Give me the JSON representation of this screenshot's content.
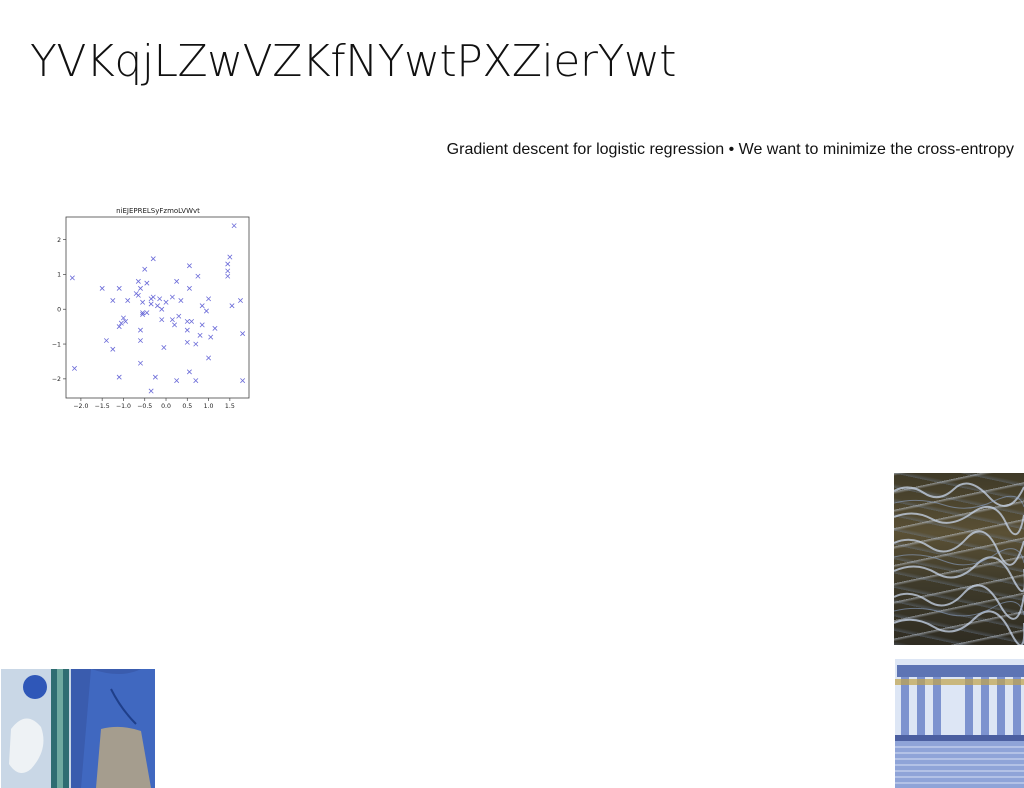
{
  "slide": {
    "title": "YVKqjLZwVZKfNYwtPXZierYwt",
    "subtitle": "Gradient descent for logistic regression • We want to minimize the cross-entropy"
  },
  "chart_data": {
    "type": "scatter",
    "title": "niEJEPRELSyFzmoLVWvt",
    "xlabel": "",
    "ylabel": "",
    "xlim": [
      -2.35,
      1.95
    ],
    "ylim": [
      -2.55,
      2.65
    ],
    "xticks": [
      "−2.0",
      "−1.5",
      "−1.0",
      "−0.5",
      "0.0",
      "0.5",
      "1.0",
      "1.5"
    ],
    "yticks": [
      "2",
      "1",
      "0",
      "−1",
      "−2"
    ],
    "marker": "x",
    "color": "#6a6ad8",
    "grid": false,
    "points": [
      [
        1.6,
        2.4
      ],
      [
        -0.3,
        1.45
      ],
      [
        1.5,
        1.5
      ],
      [
        1.45,
        1.3
      ],
      [
        1.45,
        1.1
      ],
      [
        -0.5,
        1.15
      ],
      [
        0.55,
        1.25
      ],
      [
        -2.2,
        0.9
      ],
      [
        1.45,
        0.95
      ],
      [
        0.75,
        0.95
      ],
      [
        0.25,
        0.8
      ],
      [
        -0.65,
        0.8
      ],
      [
        -0.45,
        0.75
      ],
      [
        -1.5,
        0.6
      ],
      [
        -1.1,
        0.6
      ],
      [
        -0.6,
        0.6
      ],
      [
        0.55,
        0.6
      ],
      [
        -0.7,
        0.45
      ],
      [
        -0.65,
        0.4
      ],
      [
        -0.3,
        0.35
      ],
      [
        -0.35,
        0.3
      ],
      [
        0.15,
        0.35
      ],
      [
        -0.15,
        0.3
      ],
      [
        0.35,
        0.25
      ],
      [
        -1.25,
        0.25
      ],
      [
        -0.9,
        0.25
      ],
      [
        -0.55,
        0.2
      ],
      [
        0.0,
        0.2
      ],
      [
        1.0,
        0.3
      ],
      [
        1.75,
        0.25
      ],
      [
        -0.35,
        0.15
      ],
      [
        -0.2,
        0.1
      ],
      [
        0.85,
        0.1
      ],
      [
        1.55,
        0.1
      ],
      [
        -0.1,
        0.0
      ],
      [
        0.95,
        -0.05
      ],
      [
        -0.55,
        -0.1
      ],
      [
        -0.55,
        -0.15
      ],
      [
        -0.45,
        -0.1
      ],
      [
        0.3,
        -0.2
      ],
      [
        -1.0,
        -0.25
      ],
      [
        -0.1,
        -0.3
      ],
      [
        0.15,
        -0.3
      ],
      [
        0.5,
        -0.35
      ],
      [
        0.6,
        -0.35
      ],
      [
        -1.05,
        -0.4
      ],
      [
        -0.95,
        -0.35
      ],
      [
        -1.1,
        -0.5
      ],
      [
        0.2,
        -0.45
      ],
      [
        0.85,
        -0.45
      ],
      [
        1.15,
        -0.55
      ],
      [
        0.5,
        -0.6
      ],
      [
        -0.6,
        -0.6
      ],
      [
        0.8,
        -0.75
      ],
      [
        1.05,
        -0.8
      ],
      [
        1.8,
        -0.7
      ],
      [
        -1.4,
        -0.9
      ],
      [
        -0.6,
        -0.9
      ],
      [
        0.5,
        -0.95
      ],
      [
        0.7,
        -1.0
      ],
      [
        -0.05,
        -1.1
      ],
      [
        -1.25,
        -1.15
      ],
      [
        1.0,
        -1.4
      ],
      [
        -0.6,
        -1.55
      ],
      [
        0.55,
        -1.8
      ],
      [
        -2.15,
        -1.7
      ],
      [
        -1.1,
        -1.95
      ],
      [
        -0.25,
        -1.95
      ],
      [
        0.25,
        -2.05
      ],
      [
        0.7,
        -2.05
      ],
      [
        1.8,
        -2.05
      ],
      [
        -0.35,
        -2.35
      ]
    ]
  },
  "images": {
    "texture": "water-ripple-texture",
    "portrait": "blue-tinted-portrait-with-magazine",
    "temple": "blue-tinted-classical-temple"
  }
}
